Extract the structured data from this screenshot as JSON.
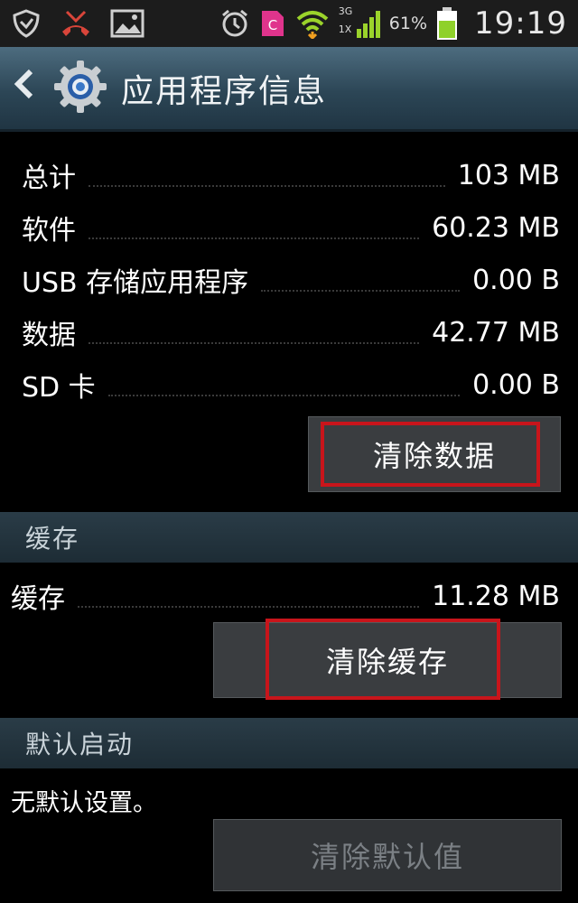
{
  "status_bar": {
    "battery_percent": "61%",
    "time": "19:19",
    "signal_label_top": "3G",
    "signal_label_bottom": "1X",
    "icons": [
      "shield-icon",
      "missed-call-icon",
      "image-icon",
      "alarm-icon",
      "app-c-icon",
      "wifi-icon",
      "signal-icon",
      "battery-icon"
    ]
  },
  "action_bar": {
    "title": "应用程序信息",
    "back_icon": "chevron-left-icon",
    "app_icon": "settings-gear-icon"
  },
  "storage": {
    "rows": [
      {
        "label": "总计",
        "value": "103 MB"
      },
      {
        "label": "软件",
        "value": "60.23 MB"
      },
      {
        "label": "USB 存储应用程序",
        "value": "0.00 B"
      },
      {
        "label": "数据",
        "value": "42.77 MB"
      },
      {
        "label": "SD 卡",
        "value": "0.00 B"
      }
    ],
    "clear_data_label": "清除数据"
  },
  "cache": {
    "header": "缓存",
    "row_label": "缓存",
    "row_value": "11.28 MB",
    "clear_cache_label": "清除缓存"
  },
  "default_launch": {
    "header": "默认启动",
    "text": "无默认设置。",
    "clear_defaults_label": "清除默认值"
  },
  "colors": {
    "highlight": "#c8151b",
    "action_bar": "#2c4656",
    "battery": "#8fd12a",
    "wifi": "#9bd32b"
  }
}
